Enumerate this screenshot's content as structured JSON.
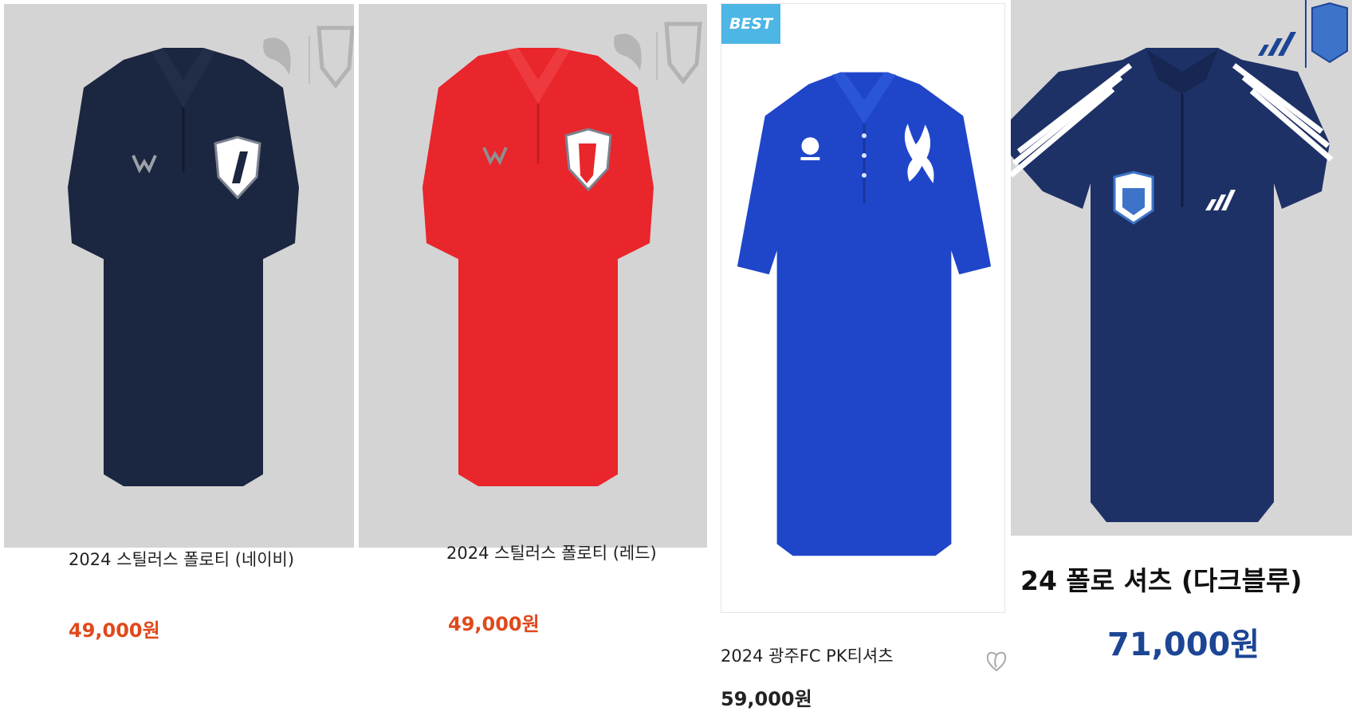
{
  "products": [
    {
      "title": "2024 스틸러스 폴로티 (네이비)",
      "price": "49,000원",
      "shirt_color": "#1b2640",
      "price_color": "#e0491b"
    },
    {
      "title": "2024 스틸러스 폴로티 (레드)",
      "price": "49,000원",
      "shirt_color": "#e8262b",
      "price_color": "#e0491b"
    },
    {
      "badge": "BEST",
      "title": "2024 광주FC PK티셔츠",
      "price": "59,000원",
      "shirt_color": "#1f46c9",
      "price_color": "#222222",
      "icon": "heart-icon"
    },
    {
      "title": "24 폴로 셔츠 (다크블루)",
      "price": "71,000원",
      "shirt_color": "#1e3167",
      "price_color": "#1d4595"
    }
  ]
}
